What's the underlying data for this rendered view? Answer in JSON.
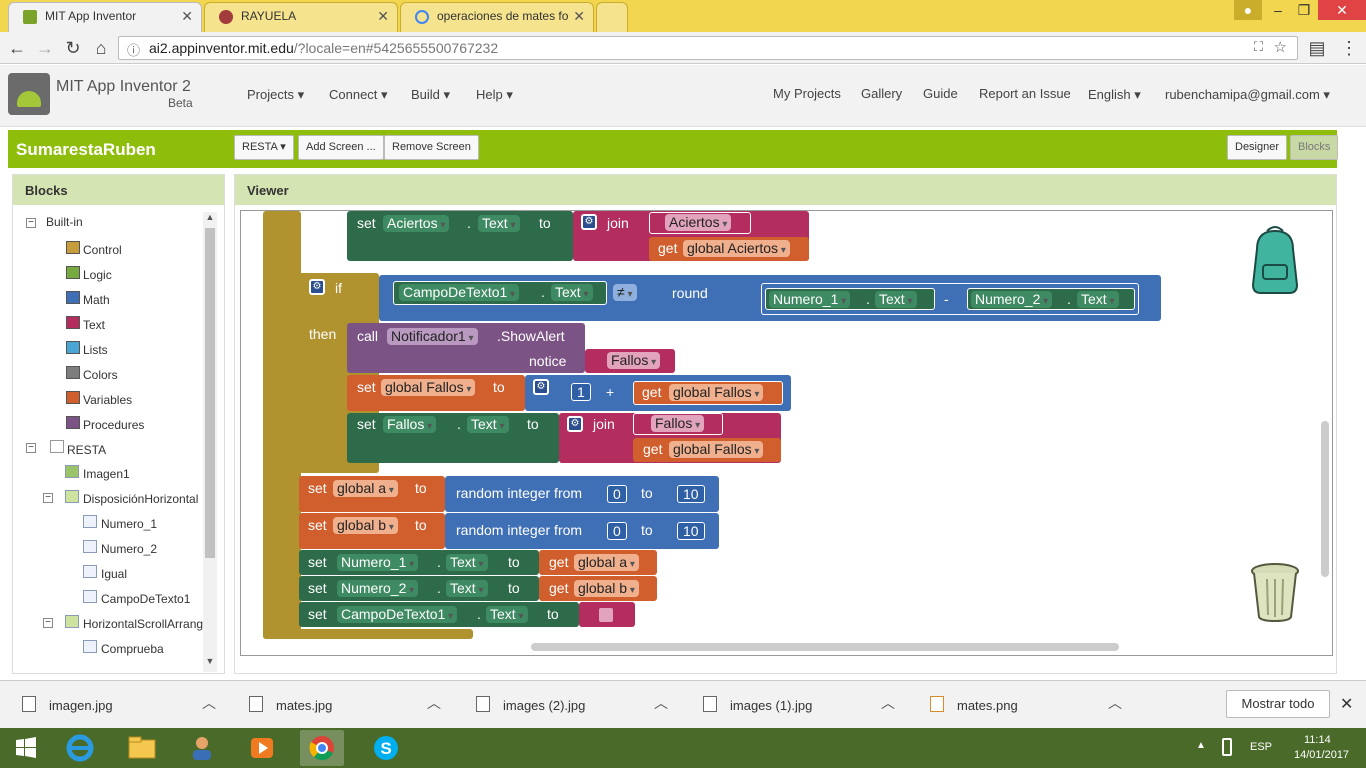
{
  "browser": {
    "tabs": [
      {
        "title": "MIT App Inventor",
        "active": true
      },
      {
        "title": "RAYUELA",
        "active": false
      },
      {
        "title": "operaciones de mates fo",
        "active": false
      }
    ],
    "url_host": "ai2.appinventor.mit.edu",
    "url_rest": "/?locale=en#5425655500767232"
  },
  "header": {
    "app_name": "MIT App Inventor 2",
    "app_sub": "Beta",
    "menus": [
      "Projects ▾",
      "Connect ▾",
      "Build ▾",
      "Help ▾"
    ],
    "right_links": [
      "My Projects",
      "Gallery",
      "Guide",
      "Report an Issue",
      "English ▾",
      "rubenchamipa@gmail.com ▾"
    ]
  },
  "project": {
    "name": "SumarestaRuben",
    "screen_select": "RESTA ▾",
    "add_screen": "Add Screen ...",
    "remove_screen": "Remove Screen",
    "designer": "Designer",
    "blocks": "Blocks"
  },
  "blocks_panel": {
    "title": "Blocks",
    "builtin": "Built-in",
    "categories": [
      {
        "label": "Control",
        "color": "#c79c3a"
      },
      {
        "label": "Logic",
        "color": "#77ab41"
      },
      {
        "label": "Math",
        "color": "#3f70b6"
      },
      {
        "label": "Text",
        "color": "#b32d5e"
      },
      {
        "label": "Lists",
        "color": "#49a6d4"
      },
      {
        "label": "Colors",
        "color": "#7d7d7d"
      },
      {
        "label": "Variables",
        "color": "#d05f2d"
      },
      {
        "label": "Procedures",
        "color": "#7c5385"
      }
    ],
    "screen": "RESTA",
    "components": [
      {
        "label": "Imagen1",
        "indent": 1,
        "icon": "image-icon"
      },
      {
        "label": "DisposiciónHorizontal",
        "indent": 1,
        "icon": "layout-icon",
        "toggle": "⊟"
      },
      {
        "label": "Numero_1",
        "indent": 2,
        "icon": "label-icon"
      },
      {
        "label": "Numero_2",
        "indent": 2,
        "icon": "label-icon"
      },
      {
        "label": "Igual",
        "indent": 2,
        "icon": "label-icon"
      },
      {
        "label": "CampoDeTexto1",
        "indent": 2,
        "icon": "textbox-icon"
      },
      {
        "label": "HorizontalScrollArrang",
        "indent": 1,
        "icon": "layout-icon",
        "toggle": "⊟"
      },
      {
        "label": "Comprueba",
        "indent": 2,
        "icon": "button-icon"
      }
    ]
  },
  "viewer": {
    "title": "Viewer",
    "blocks": {
      "set": "set",
      "to": "to",
      "join": "join",
      "get": "get",
      "if": "if",
      "then": "then",
      "call": "call",
      "notice": "notice",
      "round": "round",
      "random": "random integer from",
      "aciertos_comp": "Aciertos",
      "text_prop": "Text",
      "aciertos_str": "Aciertos",
      "global_aciertos": "global Aciertos",
      "campo": "CampoDeTexto1",
      "neq": "≠",
      "numero1": "Numero_1",
      "numero2": "Numero_2",
      "minus": "-",
      "notificador": "Notificador1",
      "showalert": ".ShowAlert",
      "fallos_str": "Fallos",
      "global_fallos": "global Fallos",
      "one": "1",
      "plus": "+",
      "fallos_comp": "Fallos",
      "global_a": "global a",
      "global_b": "global b",
      "zero": "0",
      "ten": "10",
      "dot": "."
    }
  },
  "downloads": {
    "items": [
      "imagen.jpg",
      "mates.jpg",
      "images (2).jpg",
      "images (1).jpg",
      "mates.png"
    ],
    "show_all": "Mostrar todo"
  },
  "taskbar": {
    "lang": "ESP",
    "time": "11:14",
    "date": "14/01/2017"
  }
}
